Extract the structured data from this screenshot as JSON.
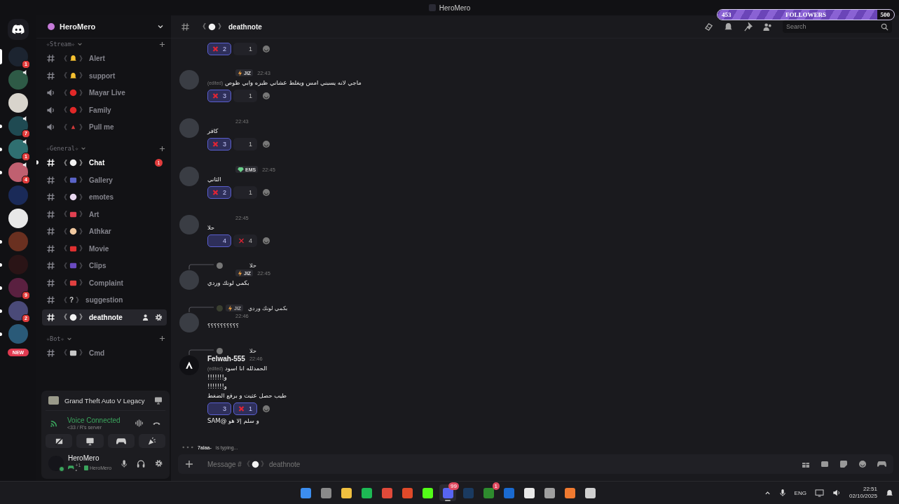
{
  "window": {
    "title": "HeroMero"
  },
  "followers": {
    "current": "453",
    "label": "FOLLOWERS",
    "goal": "500",
    "level": 0.906
  },
  "servers": [
    {
      "color": "#1c2430",
      "badge": "1",
      "unread": false,
      "selected": true,
      "speaker": false
    },
    {
      "color": "#2e5a46",
      "unread": false,
      "selected": false,
      "speaker": true
    },
    {
      "color": "#d8d4cc",
      "unread": false,
      "selected": false,
      "speaker": false
    },
    {
      "color": "#1f4a52",
      "badge": "7",
      "unread": true,
      "selected": false,
      "speaker": true
    },
    {
      "color": "#2f6f70",
      "badge": "1",
      "unread": true,
      "selected": false,
      "speaker": true
    },
    {
      "color": "#c06070",
      "badge": "4",
      "unread": true,
      "selected": false,
      "speaker": true
    },
    {
      "color": "#1a2a58",
      "unread": false,
      "selected": false,
      "speaker": false
    },
    {
      "color": "#e8e8e8",
      "unread": false,
      "selected": false,
      "speaker": false
    },
    {
      "color": "#6a3020",
      "unread": true,
      "selected": false,
      "speaker": false
    },
    {
      "color": "#2a1416",
      "unread": true,
      "selected": false,
      "speaker": false
    },
    {
      "color": "#5a2040",
      "badge": "9",
      "unread": true,
      "selected": false,
      "speaker": false
    },
    {
      "color": "#4a4a78",
      "badge": "2",
      "unread": true,
      "selected": false,
      "speaker": false
    },
    {
      "color": "#2a5a78",
      "unread": true,
      "selected": false,
      "speaker": false
    }
  ],
  "new_badge": "NEW",
  "sidebar": {
    "server_name": "HeroMero",
    "categories": [
      {
        "name": "✧Stream✧",
        "channels": [
          {
            "kind": "text",
            "open": "《",
            "emoji": {
              "kind": "bell"
            },
            "close": "》",
            "name": "Alert",
            "selected": false,
            "unread": false
          },
          {
            "kind": "text",
            "open": "《",
            "emoji": {
              "kind": "bell"
            },
            "close": "》",
            "name": "support",
            "selected": false,
            "unread": false
          },
          {
            "kind": "voice",
            "open": "《",
            "emoji": {
              "kind": "red"
            },
            "close": "》",
            "name": "Mayar Live",
            "selected": false,
            "unread": false
          },
          {
            "kind": "voice",
            "open": "《",
            "emoji": {
              "kind": "red"
            },
            "close": "》",
            "name": "Family",
            "selected": false,
            "unread": false
          },
          {
            "kind": "voice",
            "open": "《",
            "emoji": {
              "kind": "triangle"
            },
            "close": "》",
            "name": "Pull me",
            "selected": false,
            "unread": false
          }
        ]
      },
      {
        "name": "✧General✧",
        "channels": [
          {
            "kind": "text",
            "open": "《",
            "emoji": {
              "kind": "speech"
            },
            "close": "》",
            "name": "Chat",
            "selected": false,
            "unread": true,
            "badge": "1"
          },
          {
            "kind": "text",
            "open": "《",
            "emoji": {
              "kind": "gallery"
            },
            "close": "》",
            "name": "Gallery",
            "selected": false,
            "unread": false
          },
          {
            "kind": "text",
            "open": "《",
            "emoji": {
              "kind": "clown"
            },
            "close": "》",
            "name": "emotes",
            "selected": false,
            "unread": false
          },
          {
            "kind": "text",
            "open": "《",
            "emoji": {
              "kind": "pencil"
            },
            "close": "》",
            "name": "Art",
            "selected": false,
            "unread": false
          },
          {
            "kind": "text",
            "open": "《",
            "emoji": {
              "kind": "hands"
            },
            "close": "》",
            "name": "Athkar",
            "selected": false,
            "unread": false
          },
          {
            "kind": "text",
            "open": "《",
            "emoji": {
              "kind": "popcorn"
            },
            "close": "》",
            "name": "Movie",
            "selected": false,
            "unread": false
          },
          {
            "kind": "text",
            "open": "《",
            "emoji": {
              "kind": "clapper"
            },
            "close": "》",
            "name": "Clips",
            "selected": false,
            "unread": false
          },
          {
            "kind": "text",
            "open": "《",
            "emoji": {
              "kind": "siren"
            },
            "close": "》",
            "name": "Complaint",
            "selected": false,
            "unread": false
          },
          {
            "kind": "text",
            "open": "《",
            "glyph": "?",
            "close": "》",
            "name": "suggestion",
            "selected": false,
            "unread": false
          },
          {
            "kind": "text",
            "open": "《",
            "emoji": {
              "kind": "skull"
            },
            "close": "》",
            "name": "deathnote",
            "selected": true,
            "unread": false
          }
        ]
      },
      {
        "name": "✧Bot✧",
        "channels": [
          {
            "kind": "text",
            "open": "《",
            "emoji": {
              "kind": "robot"
            },
            "close": "》",
            "name": "Cmd",
            "selected": false,
            "unread": false
          }
        ]
      }
    ]
  },
  "activity": {
    "game": "Grand Theft Auto V Legacy"
  },
  "voice": {
    "status": "Voice Connected",
    "server": "<33 / R's server"
  },
  "user": {
    "name": "HeroMero",
    "status_extra": "+1 •",
    "status_name": "HeroMero"
  },
  "header": {
    "open": "《",
    "emoji": {
      "kind": "skull"
    },
    "close": "》",
    "name": "deathnote",
    "search": {
      "placeholder": "Search"
    }
  },
  "messages": [
    {
      "kind": "follow",
      "reactions": [
        {
          "emoji": {
            "kind": "cross"
          },
          "count": "2",
          "selected": true
        },
        {
          "emoji": {
            "kind": "blank"
          },
          "count": "1",
          "selected": false
        }
      ]
    },
    {
      "kind": "first",
      "tag": {
        "kind": "bolt",
        "text": "JIZ"
      },
      "time": "22:43",
      "lines": [
        {
          "text": "ماجي لانه يسبني امس ويغلط عشاني ظبره وابي ظوص",
          "edited": "(edited)"
        }
      ],
      "reactions": [
        {
          "emoji": {
            "kind": "cross"
          },
          "count": "3",
          "selected": true
        },
        {
          "emoji": {
            "kind": "blank"
          },
          "count": "1",
          "selected": false
        }
      ]
    },
    {
      "kind": "first",
      "time": "22:43",
      "lines": [
        {
          "text": "كافر"
        }
      ],
      "reactions": [
        {
          "emoji": {
            "kind": "cross"
          },
          "count": "3",
          "selected": true
        },
        {
          "emoji": {
            "kind": "blank"
          },
          "count": "1",
          "selected": false
        }
      ]
    },
    {
      "kind": "first",
      "tag": {
        "kind": "heart",
        "text": "EMS"
      },
      "time": "22:45",
      "lines": [
        {
          "text": "الثاني"
        }
      ],
      "reactions": [
        {
          "emoji": {
            "kind": "cross"
          },
          "count": "2",
          "selected": true
        },
        {
          "emoji": {
            "kind": "blank"
          },
          "count": "1",
          "selected": false
        }
      ]
    },
    {
      "kind": "first",
      "time": "22:45",
      "lines": [
        {
          "text": "حلا"
        }
      ],
      "reactions": [
        {
          "emoji": {
            "kind": "blank"
          },
          "count": "4",
          "selected": true
        },
        {
          "emoji": {
            "kind": "cross"
          },
          "count": "4",
          "selected": false
        }
      ]
    },
    {
      "kind": "first",
      "reply": {
        "text": "حلا"
      },
      "tag": {
        "kind": "bolt",
        "text": "JIZ"
      },
      "time": "22:45",
      "lines": [
        {
          "text": "بكمي لونك وردي"
        }
      ]
    },
    {
      "kind": "first",
      "reply": {
        "text": "بكمي لونك وردي",
        "tag": {
          "kind": "bolt",
          "text": "JIZ"
        }
      },
      "time": "22:46",
      "lines": [
        {
          "text": "؟؟؟؟؟؟؟؟؟؟"
        }
      ]
    },
    {
      "kind": "first",
      "reply": {
        "text": "حلا"
      },
      "author": "Felwah-555",
      "time": "22:46",
      "lines": [
        {
          "text": "الحمدلله انا اسود",
          "edited": "(edited)"
        },
        {
          "text": "و!!!!!!!"
        },
        {
          "text": "و!!!!!!!"
        },
        {
          "text": "طيب حصل عثيت و برفع الضغط"
        }
      ],
      "reactions": [
        {
          "emoji": {
            "kind": "blank"
          },
          "count": "3",
          "selected": true
        },
        {
          "emoji": {
            "kind": "cross"
          },
          "count": "1",
          "selected": true
        }
      ],
      "after": "و سلم إلا هو @SAM"
    }
  ],
  "typing": {
    "user": "7alaa-",
    "text": "is typing..."
  },
  "composer": {
    "prefix": "Message # ",
    "open": "《",
    "emoji": {
      "kind": "skull"
    },
    "close": "》",
    "name": "deathnote"
  },
  "taskbar": {
    "apps": [
      {
        "color": "#3c8ef0",
        "active": false
      },
      {
        "color": "#8a8a8a",
        "active": false
      },
      {
        "color": "#f0c040",
        "active": false
      },
      {
        "color": "#1db954",
        "active": false
      },
      {
        "color": "#e04a3a",
        "active": false
      },
      {
        "color": "#e04a2a",
        "active": false
      },
      {
        "color": "#53fc18",
        "active": false
      },
      {
        "color": "#5865f2",
        "active": true,
        "badge": "99"
      },
      {
        "color": "#1a3a60",
        "active": false
      },
      {
        "color": "#2e8b2e",
        "active": false,
        "badge": "1"
      },
      {
        "color": "#1a6ad0",
        "active": false
      },
      {
        "color": "#e8e8e8",
        "active": false
      },
      {
        "color": "#a0a0a0",
        "active": false
      },
      {
        "color": "#f07a30",
        "active": false
      },
      {
        "color": "#d0d0d0",
        "active": false
      }
    ],
    "language": "ENG",
    "time": "22:51",
    "date": "02/10/2025"
  }
}
